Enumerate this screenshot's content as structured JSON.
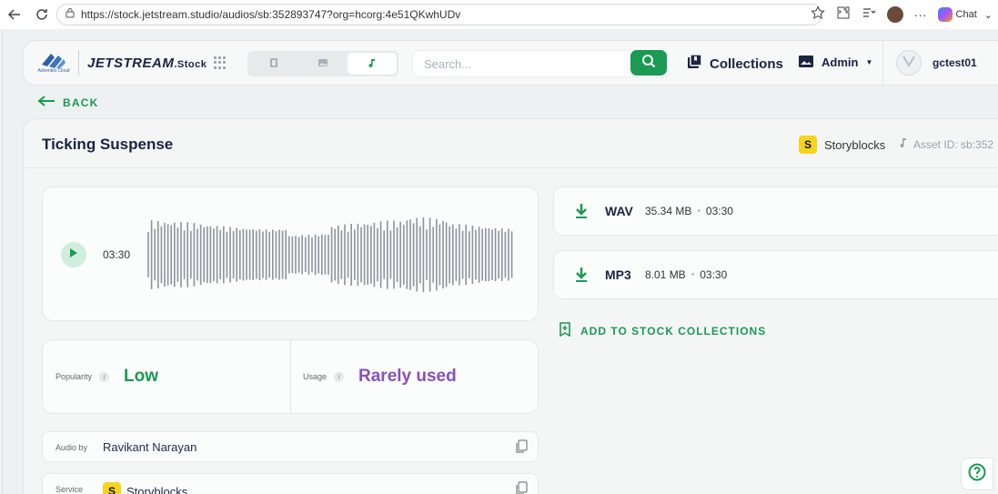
{
  "browser": {
    "url": "https://stock.jetstream.studio/audios/sb:352893747?org=hcorg:4e51QKwhUDv",
    "chat_label": "Chat"
  },
  "brand": {
    "logo_caption": "Adventist Cloud",
    "name": "JETSTREAM",
    "suffix": ".Stock"
  },
  "nav": {
    "search_placeholder": "Search...",
    "collections_label": "Collections",
    "admin_label": "Admin",
    "username": "gctest01"
  },
  "back_label": "BACK",
  "asset": {
    "title": "Ticking Suspense",
    "provider": "Storyblocks",
    "provider_badge": "S",
    "asset_id": "Asset ID: sb:352",
    "duration": "03:30",
    "popularity_label": "Popularity",
    "popularity_value": "Low",
    "usage_label": "Usage",
    "usage_value": "Rarely used",
    "audio_by_label": "Audio by",
    "audio_by_value": "Ravikant Narayan",
    "service_label": "Service",
    "service_value": "Storyblocks"
  },
  "files": [
    {
      "format": "WAV",
      "size": "35.34 MB",
      "duration": "03:30"
    },
    {
      "format": "MP3",
      "size": "8.01 MB",
      "duration": "03:30"
    }
  ],
  "add_to_collections_label": "ADD TO STOCK COLLECTIONS",
  "colors": {
    "accent": "#1a9a53",
    "usage": "#8a4fc0",
    "badge": "#f6d31c"
  }
}
